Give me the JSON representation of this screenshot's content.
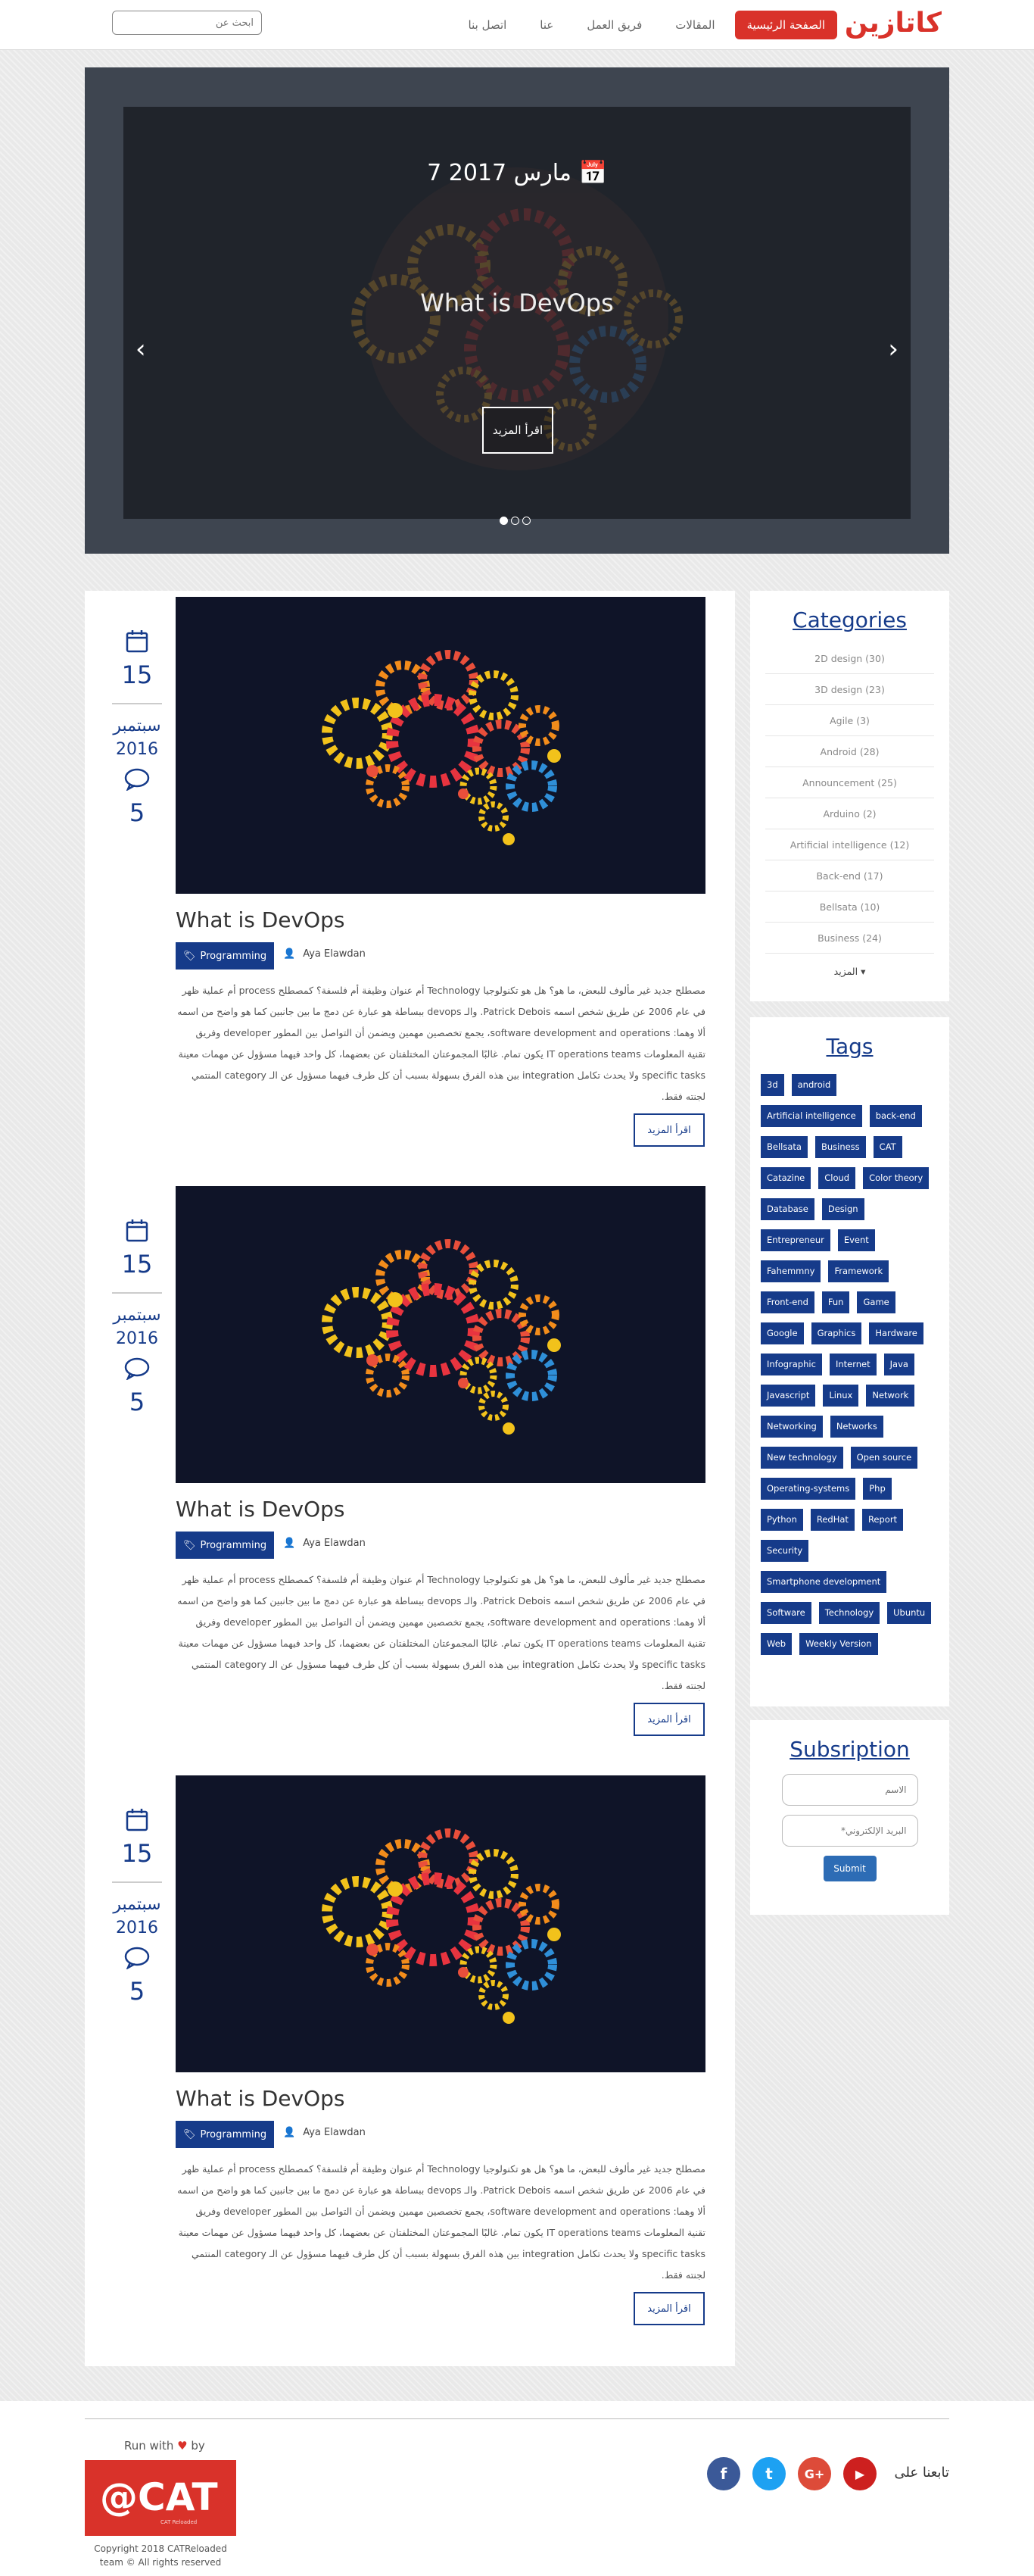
{
  "nav": {
    "brand": "كاتازين",
    "links": [
      {
        "label": "الصفحة الرئيسية",
        "active": true
      },
      {
        "label": "المقالات"
      },
      {
        "label": "فريق العمل"
      },
      {
        "label": "عنا"
      },
      {
        "label": "اتصل بنا"
      }
    ],
    "search_placeholder": "ابحث عن"
  },
  "carousel": {
    "date": "7 مارس 2017",
    "title": "What is DevOps",
    "button": "اقرأ المزيد",
    "prev": "‹",
    "next": "›",
    "active_dot": 0,
    "dot_count": 3
  },
  "posts": [
    {
      "day": "15",
      "month": "سبتمبر",
      "year": "2016",
      "comments": "5",
      "title": "What is DevOps",
      "category": "Programming",
      "author": "Aya Elawdan",
      "text": "مصطلح جديد غير مألوف للبعض، ما هو؟ هل هو تكنولوجيا Technology أم عنوان وظيفة أم فلسفة؟ كمصطلح process أم عملية ظهر في عام 2006 عن طريق شخص اسمه Patrick Debois. والـ devops ببساطة هو عبارة عن دمج ما بين جانبين كما هو واضح من اسمه ألا وهما: software development and operations، يجمع تخصصين مهمين ويضمن أن التواصل بين المطور developer وفريق تقنية المعلومات IT operations teams يكون تمام. غالبًا المجموعتان المختلفتان عن بعضهما، كل واحد فيهما مسؤول عن مهمات معينة specific tasks ولا يحدث تكامل integration بين هذه الفرق بسهولة بسبب أن كل طرف فيهما مسؤول عن الـ category المنتمي لجنته فقط.",
      "read_more": "اقرأ المزيد"
    },
    {
      "day": "15",
      "month": "سبتمبر",
      "year": "2016",
      "comments": "5",
      "title": "What is DevOps",
      "category": "Programming",
      "author": "Aya Elawdan",
      "text": "مصطلح جديد غير مألوف للبعض، ما هو؟ هل هو تكنولوجيا Technology أم عنوان وظيفة أم فلسفة؟ كمصطلح process أم عملية ظهر في عام 2006 عن طريق شخص اسمه Patrick Debois. والـ devops ببساطة هو عبارة عن دمج ما بين جانبين كما هو واضح من اسمه ألا وهما: software development and operations، يجمع تخصصين مهمين ويضمن أن التواصل بين المطور developer وفريق تقنية المعلومات IT operations teams يكون تمام. غالبًا المجموعتان المختلفتان عن بعضهما، كل واحد فيهما مسؤول عن مهمات معينة specific tasks ولا يحدث تكامل integration بين هذه الفرق بسهولة بسبب أن كل طرف فيهما مسؤول عن الـ category المنتمي لجنته فقط.",
      "read_more": "اقرأ المزيد"
    },
    {
      "day": "15",
      "month": "سبتمبر",
      "year": "2016",
      "comments": "5",
      "title": "What is DevOps",
      "category": "Programming",
      "author": "Aya Elawdan",
      "text": "مصطلح جديد غير مألوف للبعض، ما هو؟ هل هو تكنولوجيا Technology أم عنوان وظيفة أم فلسفة؟ كمصطلح process أم عملية ظهر في عام 2006 عن طريق شخص اسمه Patrick Debois. والـ devops ببساطة هو عبارة عن دمج ما بين جانبين كما هو واضح من اسمه ألا وهما: software development and operations، يجمع تخصصين مهمين ويضمن أن التواصل بين المطور developer وفريق تقنية المعلومات IT operations teams يكون تمام. غالبًا المجموعتان المختلفتان عن بعضهما، كل واحد فيهما مسؤول عن مهمات معينة specific tasks ولا يحدث تكامل integration بين هذه الفرق بسهولة بسبب أن كل طرف فيهما مسؤول عن الـ category المنتمي لجنته فقط.",
      "read_more": "اقرأ المزيد"
    }
  ],
  "categories": {
    "title": "Categories",
    "items": [
      "2D design (30)",
      "3D design (23)",
      "Agile (3)",
      "Android (28)",
      "Announcement (25)",
      "Arduino (2)",
      "Artificial intelligence (12)",
      "Back-end (17)",
      "Bellsata (10)",
      "Business (24)"
    ],
    "more": "المزيد ▾"
  },
  "tags": {
    "title": "Tags",
    "items": [
      "3d",
      "android",
      "Artificial intelligence",
      "back-end",
      "Bellsata",
      "Business",
      "CAT",
      "Catazine",
      "Cloud",
      "Color theory",
      "Database",
      "Design",
      "Entrepreneur",
      "Event",
      "Fahemmny",
      "Framework",
      "Front-end",
      "Fun",
      "Game",
      "Google",
      "Graphics",
      "Hardware",
      "Infographic",
      "Internet",
      "Java",
      "Javascript",
      "Linux",
      "Network",
      "Networking",
      "Networks",
      "New technology",
      "Open source",
      "Operating-systems",
      "Php",
      "Python",
      "RedHat",
      "Report",
      "Security",
      "Smartphone development",
      "Software",
      "Technology",
      "Ubuntu",
      "Web",
      "Weekly Version"
    ]
  },
  "subscription": {
    "title": "Subsription",
    "name_placeholder": "الاسم",
    "email_placeholder": "البريد الإلكتروني*",
    "submit": "Submit"
  },
  "footer": {
    "run_with": "Run with",
    "heart": "♥",
    "by": "by",
    "logo_text": "@CAT",
    "logo_sub": "CAT Reloaded",
    "copyright_line1": "Copyright 2018 CATReloaded",
    "copyright_line2": "team © All rights reserved",
    "follow": "تابعنا على",
    "social": [
      {
        "name": "facebook-icon",
        "glyph": "f",
        "color": "#3b5998"
      },
      {
        "name": "twitter-icon",
        "glyph": "t",
        "color": "#1da1f2"
      },
      {
        "name": "google-plus-icon",
        "glyph": "G+",
        "color": "#dd4b39"
      },
      {
        "name": "youtube-icon",
        "glyph": "▶",
        "color": "#cd201f"
      }
    ]
  },
  "colors": {
    "brand_red": "#d9322a",
    "accent_blue": "#163b8a"
  }
}
